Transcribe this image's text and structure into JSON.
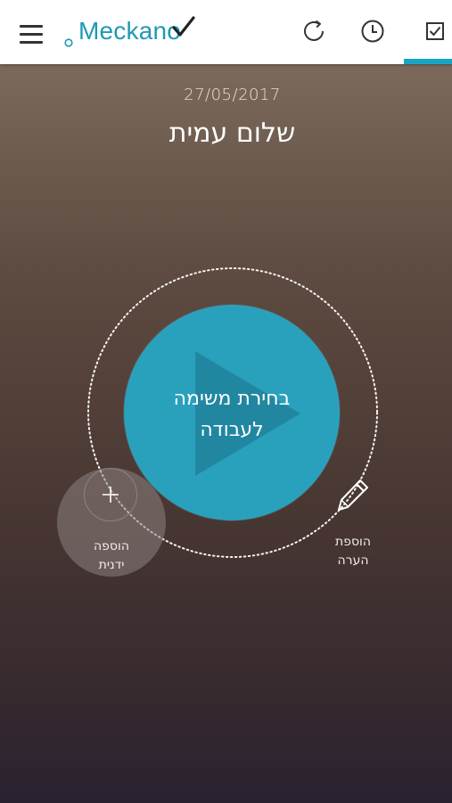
{
  "header": {
    "logo_text": "Meckano",
    "brand_color": "#1f98b5",
    "accent_color": "#19a6c6",
    "icons": [
      "menu-icon",
      "refresh-icon",
      "clock-icon",
      "checkbox-icon"
    ]
  },
  "main": {
    "date": "27/05/2017",
    "greeting": "שלום עמית",
    "start_task_label_line1": "בחירת משימה",
    "start_task_label_line2": "לעבודה",
    "manual_add_line1": "הוספה",
    "manual_add_line2": "ידנית",
    "add_note_line1": "הוספת",
    "add_note_line2": "הערה"
  }
}
